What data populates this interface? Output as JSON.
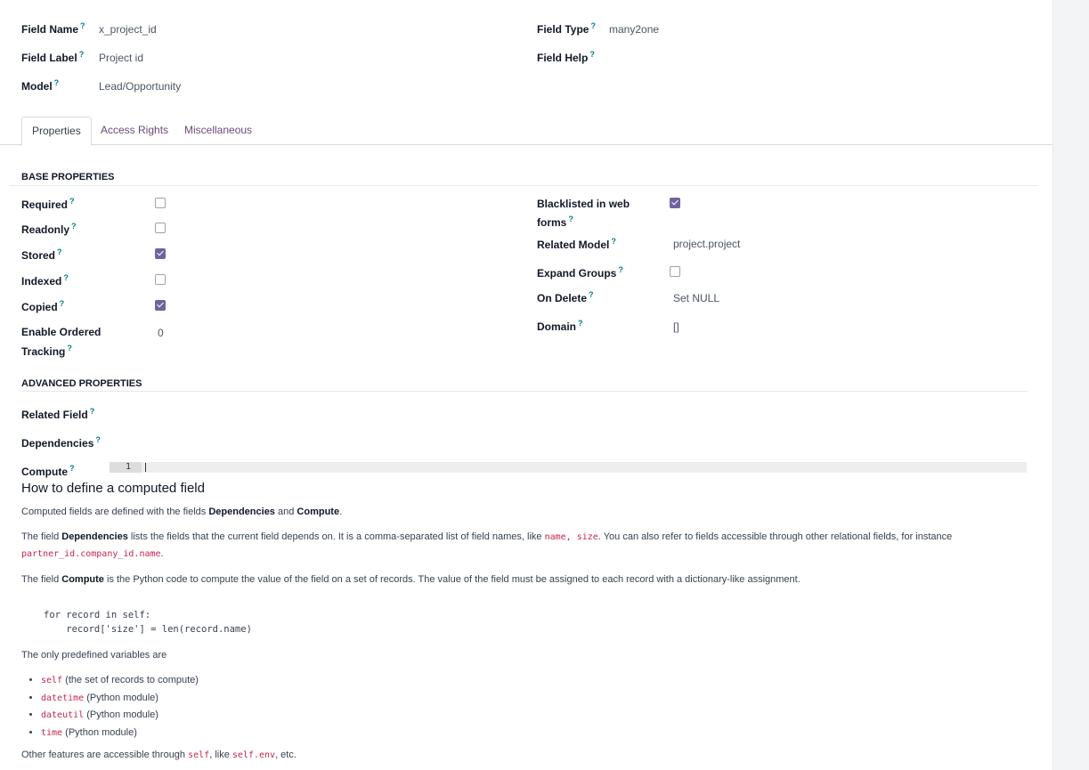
{
  "header": {
    "field_name_label": "Field Name",
    "field_name_value": "x_project_id",
    "field_label_label": "Field Label",
    "field_label_value": "Project id",
    "model_label": "Model",
    "model_value": "Lead/Opportunity",
    "field_type_label": "Field Type",
    "field_type_value": "many2one",
    "field_help_label": "Field Help",
    "help_marker": "?"
  },
  "tabs": [
    {
      "label": "Properties",
      "active": true
    },
    {
      "label": "Access Rights",
      "active": false
    },
    {
      "label": "Miscellaneous",
      "active": false
    }
  ],
  "base": {
    "title": "BASE PROPERTIES",
    "required_label": "Required",
    "required": false,
    "readonly_label": "Readonly",
    "readonly": false,
    "stored_label": "Stored",
    "stored": true,
    "indexed_label": "Indexed",
    "indexed": false,
    "copied_label": "Copied",
    "copied": true,
    "tracking_label_1": "Enable Ordered",
    "tracking_label_2": "Tracking",
    "tracking_value": "0",
    "blacklisted_label_1": "Blacklisted in web",
    "blacklisted_label_2": "forms",
    "blacklisted": true,
    "related_model_label": "Related Model",
    "related_model_value": "project.project",
    "expand_groups_label": "Expand Groups",
    "expand_groups": false,
    "on_delete_label": "On Delete",
    "on_delete_value": "Set NULL",
    "domain_label": "Domain",
    "domain_value": "[]"
  },
  "advanced": {
    "title": "ADVANCED PROPERTIES",
    "related_field_label": "Related Field",
    "dependencies_label": "Dependencies",
    "compute_label": "Compute",
    "editor_line_number": "1"
  },
  "help": {
    "title": "How to define a computed field",
    "p1_a": "Computed fields are defined with the fields ",
    "p1_b": "Dependencies",
    "p1_c": " and ",
    "p1_d": "Compute",
    "p1_e": ".",
    "p2_a": "The field ",
    "p2_b": "Dependencies",
    "p2_c": " lists the fields that the current field depends on. It is a comma-separated list of field names, like ",
    "p2_code1": "name, size",
    "p2_d": ". You can also refer to fields accessible through other relational fields, for instance",
    "p2_code2": "partner_id.company_id.name",
    "p2_e": ".",
    "p3_a": "The field ",
    "p3_b": "Compute",
    "p3_c": " is the Python code to compute the value of the field on a set of records. The value of the field must be assigned to each record with a dictionary-like assignment.",
    "code_line1": "for record in self:",
    "code_line2": "    record['size'] = len(record.name)",
    "p4": "The only predefined variables are",
    "vars": [
      {
        "code": "self",
        "desc": " (the set of records to compute)"
      },
      {
        "code": "datetime",
        "desc": " (Python module)"
      },
      {
        "code": "dateutil",
        "desc": " (Python module)"
      },
      {
        "code": "time",
        "desc": " (Python module)"
      }
    ],
    "p5_a": "Other features are accessible through ",
    "p5_code1": "self",
    "p5_b": ", like ",
    "p5_code2": "self.env",
    "p5_c": ", etc."
  },
  "colors": {
    "accent": "#71639e",
    "help_marker": "#017e84",
    "code": "#c7254e",
    "tab_link": "#6b4a7a"
  }
}
